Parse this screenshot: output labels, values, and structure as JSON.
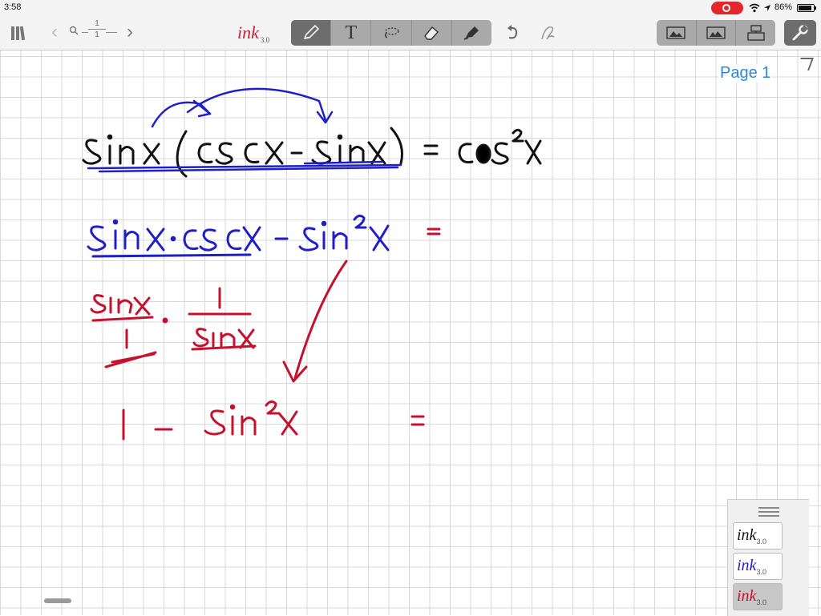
{
  "status_bar": {
    "time": "3:58",
    "battery_text": "86%",
    "battery_level": 0.86,
    "icons": [
      "screen-recording-icon",
      "wifi-icon",
      "location-icon",
      "battery-icon"
    ]
  },
  "toolbar": {
    "page_current": "1",
    "page_total": "1",
    "logo_text": "ink",
    "logo_version": "3.0",
    "text_tool_label": "T",
    "tools": [
      "pen-tool-icon",
      "text-tool-icon",
      "lasso-tool-icon",
      "eraser-tool-icon",
      "highlighter-tool-icon"
    ],
    "active_tool": "pen-tool-icon",
    "right_tools": [
      "single-page-view-icon",
      "double-page-view-icon",
      "export-icon"
    ],
    "settings_icon": "wrench-icon"
  },
  "canvas": {
    "page_label": "Page 1",
    "ink_colors": {
      "black": "#111111",
      "blue": "#1f1fc8",
      "red": "#c4122e"
    }
  },
  "swatch_panel": {
    "swatches": [
      {
        "label": "ink",
        "version": "3.0",
        "color": "#111111",
        "selected": false
      },
      {
        "label": "ink",
        "version": "3.0",
        "color": "#1f1fc8",
        "selected": false
      },
      {
        "label": "ink",
        "version": "3.0",
        "color": "#c4122e",
        "selected": true
      }
    ]
  }
}
